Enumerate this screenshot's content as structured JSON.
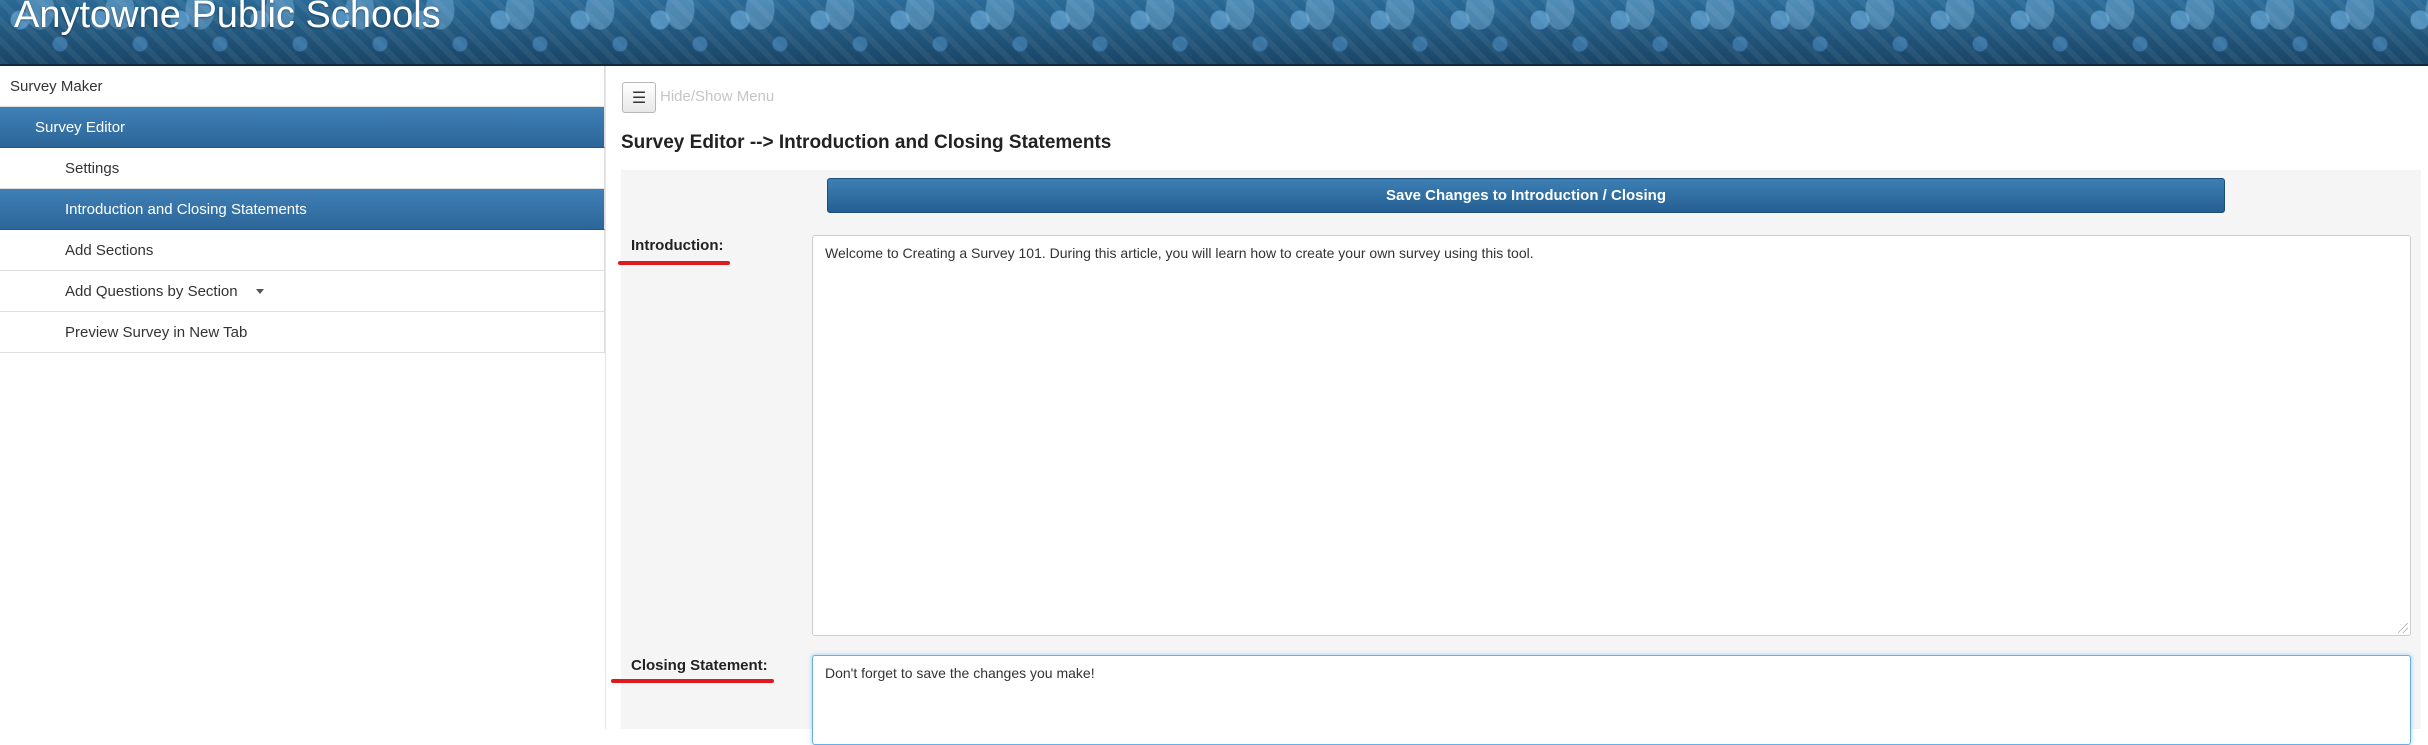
{
  "header": {
    "title": "Anytowne Public Schools"
  },
  "sidebar": {
    "items": [
      {
        "label": "Survey Maker"
      },
      {
        "label": "Survey Editor"
      },
      {
        "label": "Settings"
      },
      {
        "label": "Introduction and Closing Statements"
      },
      {
        "label": "Add Sections"
      },
      {
        "label": "Add Questions by Section"
      },
      {
        "label": "Preview Survey in New Tab"
      }
    ]
  },
  "toolbar": {
    "menu_toggle_glyph": "☰",
    "menu_toggle_label": "Hide/Show Menu"
  },
  "main": {
    "heading": "Survey Editor --> Introduction and Closing Statements",
    "save_label": "Save Changes to Introduction / Closing",
    "introduction": {
      "label": "Introduction:",
      "value": "Welcome to Creating a Survey 101. During this article, you will learn how to create your own survey using this tool."
    },
    "closing": {
      "label": "Closing Statement:",
      "value": "Don't forget to save the changes you make!"
    }
  },
  "colors": {
    "accent": "#2c6699",
    "annotation": "#e0191e",
    "header": "#1f4f73"
  }
}
